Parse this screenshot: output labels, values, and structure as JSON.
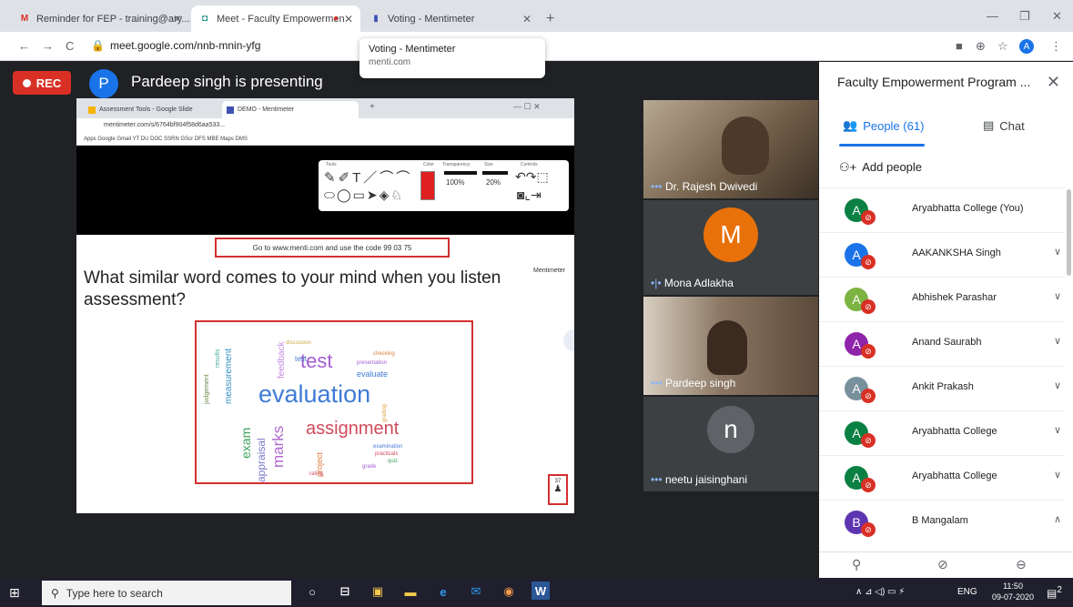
{
  "browser": {
    "tabs": [
      {
        "label": "Reminder for FEP - training@ary...",
        "icon": "gmail-icon"
      },
      {
        "label": "Meet - Faculty Empowermen",
        "icon": "meet-icon"
      },
      {
        "label": "Voting - Mentimeter",
        "icon": "mentimeter-icon"
      }
    ],
    "url": "meet.google.com/nnb-mnin-yfg",
    "tooltip": {
      "title": "Voting - Mentimeter",
      "domain": "menti.com"
    },
    "profile_initial": "A"
  },
  "meet": {
    "rec_label": "REC",
    "presenter_initial": "P",
    "presenter_text": "Pardeep singh is presenting"
  },
  "shared_screen": {
    "inner_tabs": [
      "Assessment Tools - Google Slide",
      "DEMO - Mentimeter"
    ],
    "inner_url": "mentimeter.com/s/6764bf904f58d6aa533...",
    "bookmarks": "Apps  Google  Gmail  YT  DU  DOC  SSRN  GScr  DFS  MBE  Maps  DMS",
    "toolbox": {
      "tools_label": "Tools",
      "color_label": "Color",
      "transparency_label": "Transparency",
      "size_label": "Size",
      "controls_label": "Controls",
      "transparency": "100%",
      "size": "20%"
    },
    "slide": {
      "code_text": "Go to www.menti.com and use the code 99 03 75",
      "logo": "Mentimeter",
      "question": "What similar word comes to your mind when you listen assessment?",
      "responses_count": "37",
      "cloud_words": [
        {
          "text": "evaluation",
          "color": "#3f7bd6"
        },
        {
          "text": "test",
          "color": "#a45dd2"
        },
        {
          "text": "assignment",
          "color": "#d04a5a"
        },
        {
          "text": "marks",
          "color": "#b06ad0"
        },
        {
          "text": "exam",
          "color": "#3fa35a"
        },
        {
          "text": "appraisal",
          "color": "#7a7acb"
        },
        {
          "text": "evaluate",
          "color": "#3f7bd6"
        },
        {
          "text": "measurement",
          "color": "#2f8fbf"
        },
        {
          "text": "feedback",
          "color": "#c58be0"
        },
        {
          "text": "project",
          "color": "#e07c3f"
        },
        {
          "text": "presentation",
          "color": "#a45dd2"
        },
        {
          "text": "checking",
          "color": "#e07c3f"
        },
        {
          "text": "grading",
          "color": "#e0a13f"
        },
        {
          "text": "discussion",
          "color": "#d2a84a"
        },
        {
          "text": "examination",
          "color": "#4a7bd6"
        },
        {
          "text": "practicals",
          "color": "#d04a5a"
        },
        {
          "text": "judgement",
          "color": "#6a8a4a"
        },
        {
          "text": "results",
          "color": "#4ab0a0"
        },
        {
          "text": "grade",
          "color": "#a45dd2"
        },
        {
          "text": "quiz",
          "color": "#3fa35a"
        },
        {
          "text": "rating",
          "color": "#d04a5a"
        },
        {
          "text": "test",
          "color": "#4a7bd6"
        }
      ]
    }
  },
  "participants_tiles": [
    {
      "name": "Dr. Rajesh Dwivedi",
      "initial": "",
      "color": "#8d7a62"
    },
    {
      "name": "Mona Adlakha",
      "initial": "M",
      "color": "#e8710a"
    },
    {
      "name": "Pardeep singh",
      "initial": "",
      "color": "#6b5a48"
    },
    {
      "name": "neetu jaisinghani",
      "initial": "n",
      "color": "#5f6368"
    }
  ],
  "panel": {
    "title": "Faculty Empowerment Program ...",
    "people_tab": "People (61)",
    "chat_tab": "Chat",
    "add_people": "Add people",
    "people": [
      {
        "initial": "A",
        "name": "Aryabhatta College (You)",
        "color": "#0b8043",
        "chevron": ""
      },
      {
        "initial": "A",
        "name": "AAKANKSHA Singh",
        "color": "#1a73e8",
        "chevron": "∨"
      },
      {
        "initial": "A",
        "name": "Abhishek Parashar",
        "color": "#7cb342",
        "chevron": "∨"
      },
      {
        "initial": "A",
        "name": "Anand Saurabh",
        "color": "#8e24aa",
        "chevron": "∨"
      },
      {
        "initial": "A",
        "name": "Ankit Prakash",
        "color": "#78909c",
        "chevron": "∨"
      },
      {
        "initial": "A",
        "name": "Aryabhatta College",
        "color": "#0b8043",
        "chevron": "∨"
      },
      {
        "initial": "A",
        "name": "Aryabhatta College",
        "color": "#0b8043",
        "chevron": "∨"
      },
      {
        "initial": "B",
        "name": "B Mangalam",
        "color": "#5e35b1",
        "chevron": "∧"
      }
    ]
  },
  "taskbar": {
    "search_placeholder": "Type here to search",
    "lang": "ENG",
    "time": "11:50",
    "date": "09-07-2020",
    "notifications": "2"
  },
  "colors": {
    "rec": "#d93025",
    "accent": "#1a73e8",
    "dark_bg": "#202124"
  }
}
